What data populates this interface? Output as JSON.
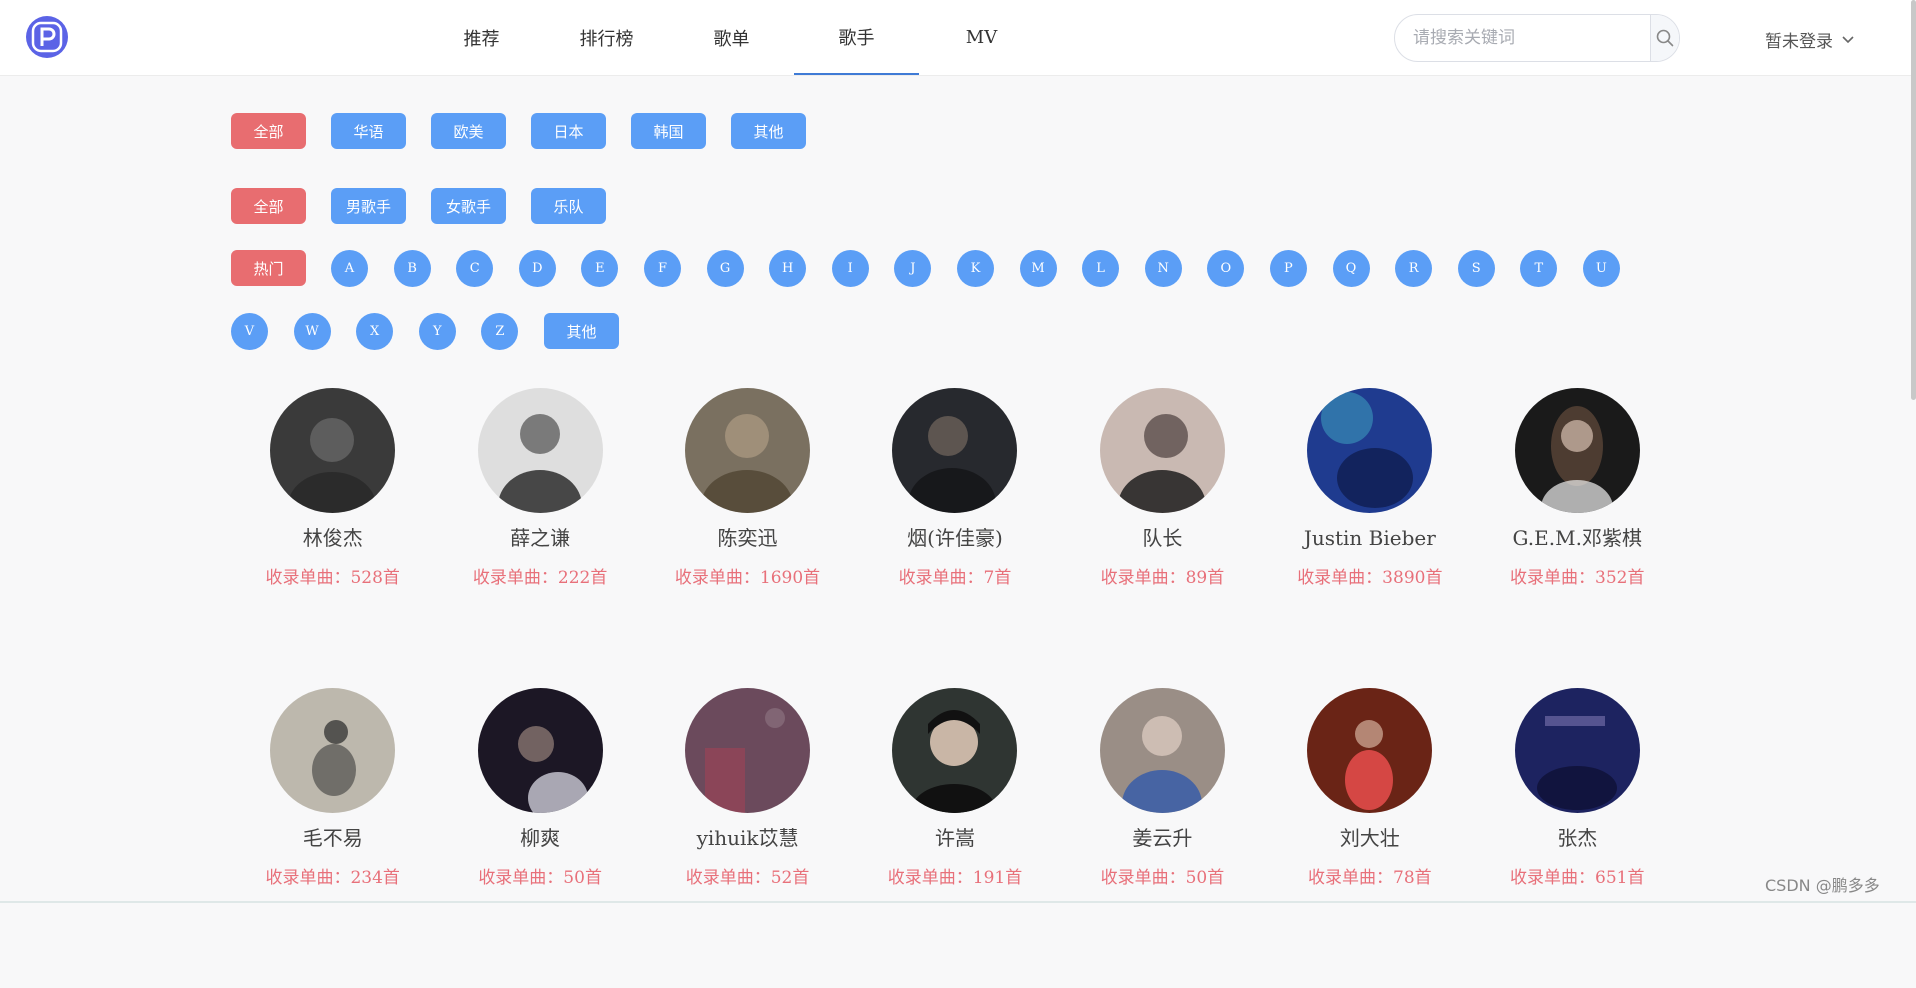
{
  "nav": {
    "items": [
      "推荐",
      "排行榜",
      "歌单",
      "歌手",
      "MV"
    ],
    "active": "歌手"
  },
  "search": {
    "placeholder": "请搜索关键词"
  },
  "login": {
    "label": "暂未登录"
  },
  "filters": {
    "area": [
      "全部",
      "华语",
      "欧美",
      "日本",
      "韩国",
      "其他"
    ],
    "type": [
      "全部",
      "男歌手",
      "女歌手",
      "乐队"
    ],
    "hot_label": "热门",
    "letters": [
      "A",
      "B",
      "C",
      "D",
      "E",
      "F",
      "G",
      "H",
      "I",
      "J",
      "K",
      "M",
      "L",
      "N",
      "O",
      "P",
      "Q",
      "R",
      "S",
      "T",
      "U",
      "V",
      "W",
      "X",
      "Y",
      "Z"
    ],
    "other_label": "其他"
  },
  "artists": [
    {
      "name": "林俊杰",
      "count": "收录单曲：528首",
      "color": "#3a3a3a"
    },
    {
      "name": "薛之谦",
      "count": "收录单曲：222首",
      "color": "#dedede"
    },
    {
      "name": "陈奕迅",
      "count": "收录单曲：1690首",
      "color": "#7a7060"
    },
    {
      "name": "烟(许佳豪)",
      "count": "收录单曲：7首",
      "color": "#27292e"
    },
    {
      "name": "队长",
      "count": "收录单曲：89首",
      "color": "#c9b9b2"
    },
    {
      "name": "Justin Bieber",
      "count": "收录单曲：3890首",
      "color": "#1f3b8f"
    },
    {
      "name": "G.E.M.邓紫棋",
      "count": "收录单曲：352首",
      "color": "#1a1a1a"
    },
    {
      "name": "毛不易",
      "count": "收录单曲：234首",
      "color": "#bdb8ad"
    },
    {
      "name": "柳爽",
      "count": "收录单曲：50首",
      "color": "#1c1725"
    },
    {
      "name": "yihuik苡慧",
      "count": "收录单曲：52首",
      "color": "#6b4a5c"
    },
    {
      "name": "许嵩",
      "count": "收录单曲：191首",
      "color": "#2f3532"
    },
    {
      "name": "姜云升",
      "count": "收录单曲：50首",
      "color": "#9a8e86"
    },
    {
      "name": "刘大壮",
      "count": "收录单曲：78首",
      "color": "#6a2416"
    },
    {
      "name": "张杰",
      "count": "收录单曲：651首",
      "color": "#1d2360"
    }
  ],
  "watermark": "CSDN @鹏多多"
}
